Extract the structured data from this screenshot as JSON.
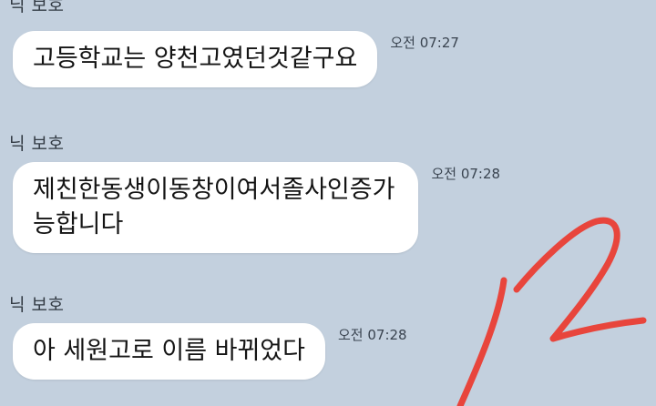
{
  "messages": [
    {
      "sender": "닉 보호",
      "text": "고등학교는 양천고였던것같구요",
      "time": "오전 07:27"
    },
    {
      "sender": "닉 보호",
      "text_lines": [
        "제친한동생이동창이여서졸사인증가",
        "능합니다"
      ],
      "time": "오전 07:28"
    },
    {
      "sender": "닉 보호",
      "text": "아 세원고로 이름 바뀌었다",
      "time": "오전 07:28"
    }
  ],
  "annotation": {
    "color": "#e8453c"
  }
}
